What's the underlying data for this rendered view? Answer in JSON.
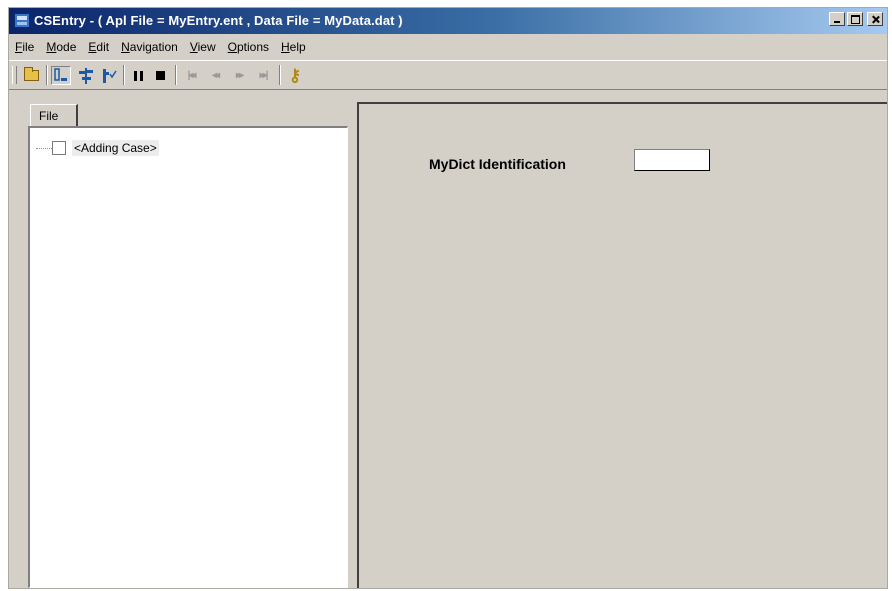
{
  "window": {
    "title": "CSEntry - ( Apl File = MyEntry.ent , Data File = MyData.dat )",
    "controls": [
      "minimize",
      "maximize",
      "close"
    ]
  },
  "menubar": {
    "items": [
      {
        "label": "File",
        "accel": "F"
      },
      {
        "label": "Mode",
        "accel": "M"
      },
      {
        "label": "Edit",
        "accel": "E"
      },
      {
        "label": "Navigation",
        "accel": "N"
      },
      {
        "label": "View",
        "accel": "V"
      },
      {
        "label": "Options",
        "accel": "O"
      },
      {
        "label": "Help",
        "accel": "H"
      }
    ]
  },
  "toolbar": {
    "buttons": [
      {
        "name": "open-icon",
        "enabled": true
      },
      {
        "name": "case-tree-icon",
        "enabled": true
      },
      {
        "name": "add-mode-icon",
        "enabled": true
      },
      {
        "name": "modify-mode-icon",
        "enabled": true
      },
      {
        "name": "pause-icon",
        "enabled": true
      },
      {
        "name": "stop-icon",
        "enabled": true
      },
      {
        "name": "first-case-icon",
        "enabled": false
      },
      {
        "name": "previous-case-icon",
        "enabled": false
      },
      {
        "name": "next-case-icon",
        "enabled": false
      },
      {
        "name": "last-case-icon",
        "enabled": false
      },
      {
        "name": "help-key-icon",
        "enabled": true
      }
    ]
  },
  "left_panel": {
    "tab_label": "File",
    "tree_items": [
      {
        "label": "<Adding Case>",
        "checked": false
      }
    ]
  },
  "form": {
    "field_label": "MyDict Identification",
    "field_value": ""
  }
}
